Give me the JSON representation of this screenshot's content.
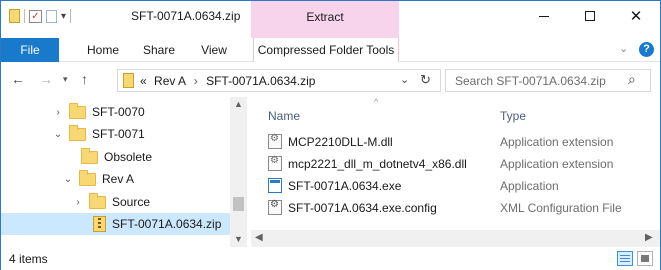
{
  "title_bar": {
    "window_title": "SFT-0071A.0634.zip",
    "contextual_group": "Extract",
    "minimize_icon": "minimize-icon",
    "maximize_icon": "maximize-icon",
    "close_icon": "close-icon"
  },
  "ribbon": {
    "tabs": [
      {
        "label": "File"
      },
      {
        "label": "Home"
      },
      {
        "label": "Share"
      },
      {
        "label": "View"
      },
      {
        "label": "Compressed Folder Tools"
      }
    ]
  },
  "address_bar": {
    "overflow": "«",
    "crumbs": [
      "Rev A",
      "SFT-0071A.0634.zip"
    ],
    "separator": "›"
  },
  "search": {
    "placeholder": "Search SFT-0071A.0634.zip"
  },
  "nav_tree": [
    {
      "label": "SFT-0070",
      "expander": "›",
      "kind": "folder"
    },
    {
      "label": "SFT-0071",
      "expander": "⌄",
      "kind": "folder"
    },
    {
      "label": "Obsolete",
      "expander": "",
      "kind": "folder"
    },
    {
      "label": "Rev A",
      "expander": "⌄",
      "kind": "folder"
    },
    {
      "label": "Source",
      "expander": "›",
      "kind": "folder"
    },
    {
      "label": "SFT-0071A.0634.zip",
      "expander": "",
      "kind": "zip",
      "selected": true
    }
  ],
  "file_list": {
    "columns": {
      "name": "Name",
      "type": "Type"
    },
    "rows": [
      {
        "name": "MCP2210DLL-M.dll",
        "type": "Application extension",
        "icon": "dll-icon"
      },
      {
        "name": "mcp2221_dll_m_dotnetv4_x86.dll",
        "type": "Application extension",
        "icon": "dll-icon"
      },
      {
        "name": "SFT-0071A.0634.exe",
        "type": "Application",
        "icon": "exe-icon"
      },
      {
        "name": "SFT-0071A.0634.exe.config",
        "type": "XML Configuration File",
        "icon": "config-icon"
      }
    ]
  },
  "status_bar": {
    "item_count": "4 items"
  },
  "colors": {
    "accent": "#1979ca",
    "context_tab": "#f7d3ec",
    "selection": "#cce8ff",
    "folder": "#f8d775"
  }
}
